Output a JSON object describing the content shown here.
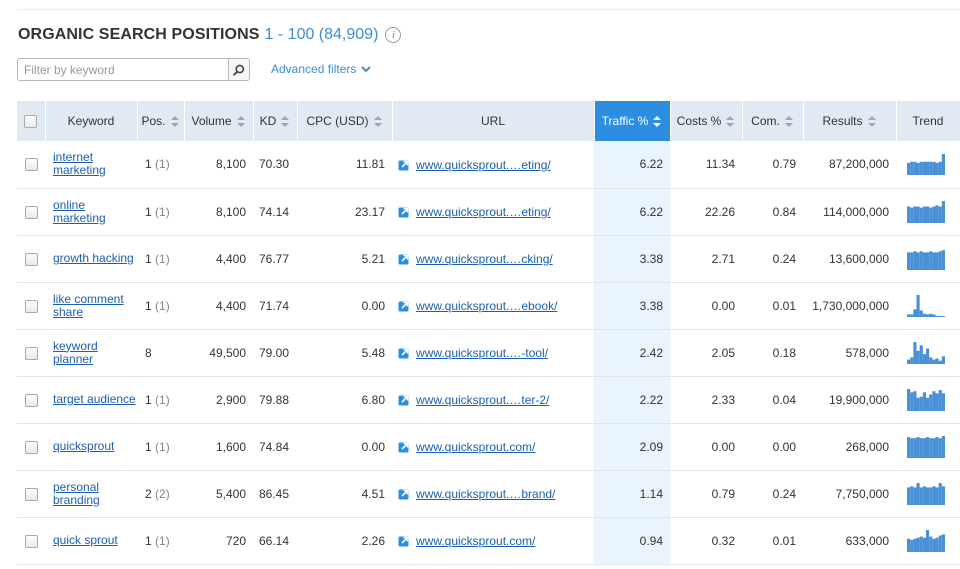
{
  "header": {
    "title": "ORGANIC SEARCH POSITIONS",
    "range": "1 - 100 (84,909)",
    "info_icon": "info-icon"
  },
  "filter": {
    "placeholder": "Filter by keyword",
    "value": "",
    "button_icon": "search-icon"
  },
  "advanced_filters": {
    "label": "Advanced filters",
    "icon": "chevron-down-icon"
  },
  "table": {
    "columns": [
      "",
      "Keyword",
      "Pos.",
      "Volume",
      "KD",
      "CPC (USD)",
      "URL",
      "Traffic %",
      "Costs %",
      "Com.",
      "Results",
      "Trend"
    ],
    "sorted_column": "Traffic %",
    "rows": [
      {
        "keyword": "internet marketing",
        "pos": "1",
        "prev": "(1)",
        "volume": "8,100",
        "kd": "70.30",
        "cpc": "11.81",
        "url": "www.quicksprout.…eting/",
        "traffic": "6.22",
        "costs": "11.34",
        "com": "0.79",
        "results": "87,200,000",
        "trend": [
          0.55,
          0.6,
          0.6,
          0.55,
          0.6,
          0.6,
          0.6,
          0.6,
          0.6,
          0.55,
          0.6,
          0.95
        ]
      },
      {
        "keyword": "online marketing",
        "pos": "1",
        "prev": "(1)",
        "volume": "8,100",
        "kd": "74.14",
        "cpc": "23.17",
        "url": "www.quicksprout.…eting/",
        "traffic": "6.22",
        "costs": "22.26",
        "com": "0.84",
        "results": "114,000,000",
        "trend": [
          0.75,
          0.7,
          0.75,
          0.75,
          0.7,
          0.75,
          0.75,
          0.7,
          0.75,
          0.8,
          0.75,
          1.0
        ]
      },
      {
        "keyword": "growth hacking",
        "pos": "1",
        "prev": "(1)",
        "volume": "4,400",
        "kd": "76.77",
        "cpc": "5.21",
        "url": "www.quicksprout.…cking/",
        "traffic": "3.38",
        "costs": "2.71",
        "com": "0.24",
        "results": "13,600,000",
        "trend": [
          0.8,
          0.8,
          0.85,
          0.8,
          0.85,
          0.8,
          0.8,
          0.85,
          0.8,
          0.8,
          0.85,
          0.9
        ]
      },
      {
        "keyword": "like comment share",
        "pos": "1",
        "prev": "(1)",
        "volume": "4,400",
        "kd": "71.74",
        "cpc": "0.00",
        "url": "www.quicksprout.…ebook/",
        "traffic": "3.38",
        "costs": "0.00",
        "com": "0.01",
        "results": "1,730,000,000",
        "trend": [
          0.12,
          0.12,
          0.35,
          1.0,
          0.3,
          0.15,
          0.12,
          0.15,
          0.12,
          0.0,
          0.0,
          0.0
        ]
      },
      {
        "keyword": "keyword planner",
        "pos": "8",
        "prev": "",
        "volume": "49,500",
        "kd": "79.00",
        "cpc": "5.48",
        "url": "www.quicksprout.…-tool/",
        "traffic": "2.42",
        "costs": "2.05",
        "com": "0.18",
        "results": "578,000",
        "trend": [
          0.2,
          0.3,
          1.0,
          0.6,
          0.85,
          0.45,
          0.7,
          0.3,
          0.2,
          0.25,
          0.15,
          0.35
        ]
      },
      {
        "keyword": "target audience",
        "pos": "1",
        "prev": "(1)",
        "volume": "2,900",
        "kd": "79.88",
        "cpc": "6.80",
        "url": "www.quicksprout.…ter-2/",
        "traffic": "2.22",
        "costs": "2.33",
        "com": "0.04",
        "results": "19,900,000",
        "trend": [
          1.0,
          0.85,
          0.9,
          0.6,
          0.65,
          0.85,
          0.6,
          0.75,
          0.9,
          0.8,
          0.95,
          0.8
        ]
      },
      {
        "keyword": "quicksprout",
        "pos": "1",
        "prev": "(1)",
        "volume": "1,600",
        "kd": "74.84",
        "cpc": "0.00",
        "url": "www.quicksprout.com/",
        "traffic": "2.09",
        "costs": "0.00",
        "com": "0.00",
        "results": "268,000",
        "trend": [
          0.95,
          0.9,
          0.9,
          0.95,
          0.9,
          0.9,
          0.95,
          0.9,
          0.9,
          0.95,
          0.9,
          1.0
        ]
      },
      {
        "keyword": "personal branding",
        "pos": "2",
        "prev": "(2)",
        "volume": "5,400",
        "kd": "86.45",
        "cpc": "4.51",
        "url": "www.quicksprout.…brand/",
        "traffic": "1.14",
        "costs": "0.79",
        "com": "0.24",
        "results": "7,750,000",
        "trend": [
          0.8,
          0.85,
          0.8,
          1.0,
          0.8,
          0.85,
          0.8,
          0.8,
          0.85,
          0.8,
          1.0,
          0.85
        ]
      },
      {
        "keyword": "quick sprout",
        "pos": "1",
        "prev": "(1)",
        "volume": "720",
        "kd": "66.14",
        "cpc": "2.26",
        "url": "www.quicksprout.com/",
        "traffic": "0.94",
        "costs": "0.32",
        "com": "0.01",
        "results": "633,000",
        "trend": [
          0.6,
          0.55,
          0.6,
          0.65,
          0.7,
          0.65,
          1.0,
          0.7,
          0.6,
          0.65,
          0.75,
          0.8
        ]
      }
    ]
  },
  "colors": {
    "accent": "#2b8ee0",
    "header_bg": "#e1eaf2",
    "link": "#1a5fb4",
    "trend_bar": "#4a90d6",
    "highlight_col": "#eaf4fd"
  }
}
